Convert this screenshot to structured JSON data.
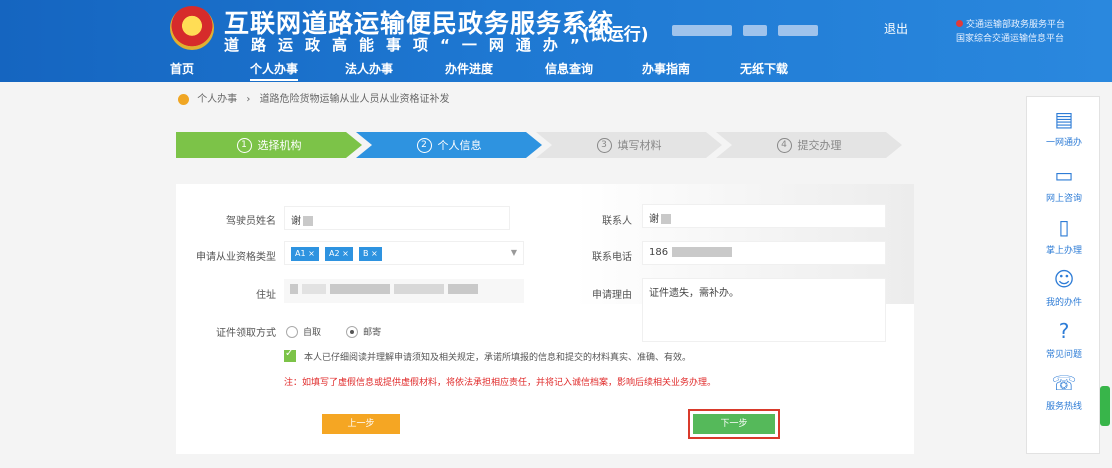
{
  "header": {
    "title": "互联网道路运输便民政务服务系统",
    "subtitle": "道路运政高能事项“一网通办”",
    "trial": "(试运行)",
    "logout": "退出",
    "corner_notice_1": "交通运输部政务服务平台",
    "corner_notice_2": "国家综合交通运输信息平台"
  },
  "nav": {
    "items": [
      "首页",
      "个人办事",
      "法人办事",
      "办件进度",
      "信息查询",
      "办事指南",
      "无纸下载"
    ],
    "active_index": 1
  },
  "breadcrumb": {
    "home": "个人办事",
    "separator": "›",
    "current": "道路危险货物运输从业人员从业资格证补发"
  },
  "steps": [
    {
      "num": "1",
      "label": "选择机构",
      "state": "done"
    },
    {
      "num": "2",
      "label": "个人信息",
      "state": "current"
    },
    {
      "num": "3",
      "label": "填写材料",
      "state": "pending"
    },
    {
      "num": "4",
      "label": "提交办理",
      "state": "pending"
    }
  ],
  "form": {
    "applicant_label": "驾驶员姓名",
    "applicant_value": "谢",
    "contact_label": "联系人",
    "contact_value": "谢",
    "type_label": "申请从业资格类型",
    "type_tags": [
      "A1 ×",
      "A2 ×",
      "B ×"
    ],
    "phone_label": "联系电话",
    "phone_value": "186",
    "address_label": "住址",
    "remark_label": "申请理由",
    "remark_value": "证件遗失，需补办。",
    "receive_label": "证件领取方式",
    "receive_options": [
      "自取",
      "邮寄"
    ],
    "receive_selected": 1,
    "agree_text": "本人已仔细阅读并理解申请须知及相关规定，承诺所填报的信息和提交的材料真实、准确、有效。",
    "warning_text": "注：如填写了虚假信息或提供虚假材料，将依法承担相应责任，并将记入诚信档案，影响后续相关业务办理。",
    "prev_button": "上一步",
    "next_button": "下一步"
  },
  "sidebar": {
    "items": [
      {
        "icon": "document-icon",
        "label": "一网通办"
      },
      {
        "icon": "chat-icon",
        "label": "网上咨询"
      },
      {
        "icon": "phone-device-icon",
        "label": "掌上办理"
      },
      {
        "icon": "person-search-icon",
        "label": "我的办件"
      },
      {
        "icon": "question-icon",
        "label": "常见问题"
      },
      {
        "icon": "telephone-icon",
        "label": "服务热线"
      }
    ]
  },
  "colors": {
    "header_blue": "#1e78d2",
    "step_done": "#7cc348",
    "step_current": "#2e93e0",
    "prev_button": "#f5a623",
    "next_button": "#55b95a",
    "warning": "#e02b2b",
    "highlight_border": "#d93a2b"
  }
}
